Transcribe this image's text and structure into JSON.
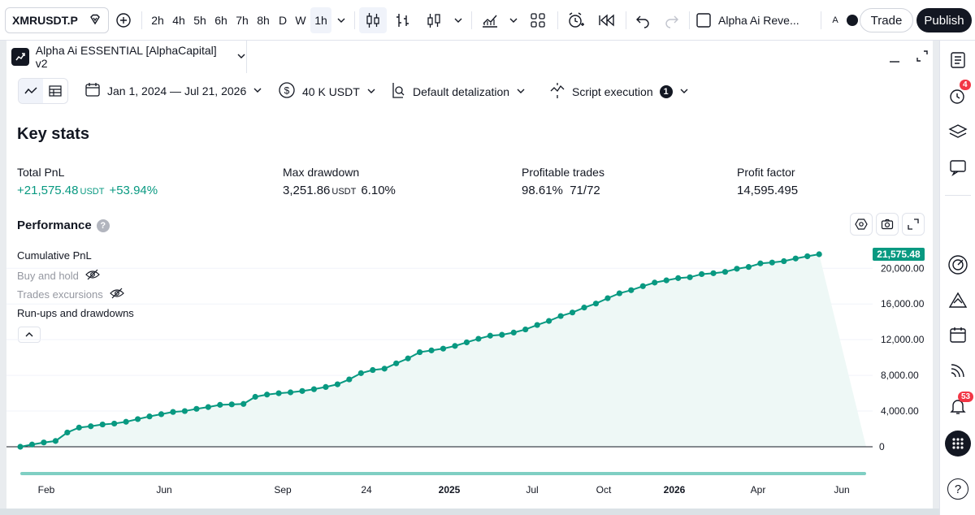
{
  "toolbar": {
    "symbol": "XMRUSDT.P",
    "intervals": [
      "2h",
      "4h",
      "5h",
      "6h",
      "7h",
      "8h",
      "D",
      "W",
      "1h"
    ],
    "active_interval": "1h",
    "layout_name": "Alpha Ai Reve...",
    "avatar_letter": "A",
    "trade_label": "Trade",
    "publish_label": "Publish"
  },
  "panel": {
    "strategy_title": "Alpha Ai ESSENTIAL [AlphaCapital] v2",
    "date_range": "Jan 1, 2024 — Jul 21, 2026",
    "capital": "40 K USDT",
    "detalization": "Default detalization",
    "script_execution": "Script execution",
    "script_execution_count": "1"
  },
  "key_stats": {
    "title": "Key stats",
    "total_pnl": {
      "label": "Total PnL",
      "value": "+21,575.48",
      "unit": "USDT",
      "percent": "+53.94%"
    },
    "max_drawdown": {
      "label": "Max drawdown",
      "value": "3,251.86",
      "unit": "USDT",
      "percent": "6.10%"
    },
    "profitable_trades": {
      "label": "Profitable trades",
      "value": "98.61%",
      "count": "71/72"
    },
    "profit_factor": {
      "label": "Profit factor",
      "value": "14,595.495"
    }
  },
  "performance": {
    "title": "Performance",
    "help": "?",
    "legend": {
      "cumulative": "Cumulative PnL",
      "buy_hold": "Buy and hold",
      "excursions": "Trades excursions",
      "runups": "Run-ups and drawdowns"
    }
  },
  "sidebar": {
    "alerts_badge": "4",
    "notifications_badge": "53",
    "help_label": "?"
  },
  "colors": {
    "accent": "#089981",
    "area_fill": "#eef8f6",
    "dark": "#131722",
    "badge": "#f23645"
  },
  "chart_data": {
    "type": "line",
    "series": [
      {
        "name": "Cumulative PnL",
        "color": "#089981"
      }
    ],
    "x": [
      0,
      1,
      2,
      3,
      4,
      5,
      6,
      7,
      8,
      9,
      10,
      11,
      12,
      13,
      14,
      15,
      16,
      17,
      18,
      19,
      20,
      21,
      22,
      23,
      24,
      25,
      26,
      27,
      28,
      29,
      30,
      31,
      32,
      33,
      34,
      35,
      36,
      37,
      38,
      39,
      40,
      41,
      42,
      43,
      44,
      45,
      46,
      47,
      48,
      49,
      50,
      51,
      52,
      53,
      54,
      55,
      56,
      57,
      58,
      59,
      60,
      61,
      62,
      63,
      64,
      65,
      66,
      67,
      68,
      69,
      70,
      71,
      72
    ],
    "y": [
      0,
      250,
      480,
      650,
      1600,
      2150,
      2300,
      2500,
      2600,
      2800,
      3100,
      3400,
      3650,
      3900,
      4000,
      4250,
      4450,
      4700,
      4750,
      4800,
      5600,
      5850,
      6000,
      6100,
      6250,
      6450,
      6700,
      7000,
      7550,
      8250,
      8600,
      8750,
      9350,
      9900,
      10600,
      10800,
      11000,
      11300,
      11700,
      12100,
      12450,
      12550,
      12800,
      13150,
      13650,
      14100,
      14650,
      15050,
      15600,
      16050,
      16650,
      17200,
      17550,
      18000,
      18400,
      18650,
      18900,
      19000,
      19350,
      19450,
      19600,
      19950,
      20150,
      20550,
      20650,
      20800,
      21100,
      21350,
      21575.48
    ],
    "ylim": [
      0,
      21575.48
    ],
    "yticks": [
      "0",
      "4,000.00",
      "8,000.00",
      "12,000.00",
      "16,000.00",
      "20,000.00"
    ],
    "ytick_values": [
      0,
      4000,
      8000,
      12000,
      16000,
      20000
    ],
    "xticks": [
      "Feb",
      "Jun",
      "Sep",
      "24",
      "2025",
      "Jul",
      "Oct",
      "2026",
      "Apr",
      "Jun"
    ],
    "xticks_bold": [
      "2025",
      "2026"
    ],
    "last_value_label": "21,575.48",
    "grid": true
  }
}
